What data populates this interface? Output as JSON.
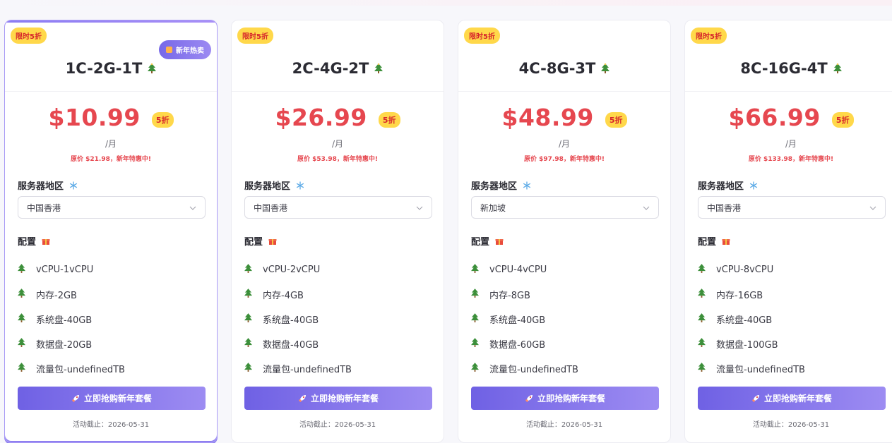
{
  "plans": [
    {
      "limited_tag": "限时5折",
      "hot_badge": "新年热卖",
      "title": "1C-2G-1T",
      "price": "$10.99",
      "discount": "5折",
      "per_month": "/月",
      "original_price": "原价 $21.98，新年特惠中!",
      "region_label": "服务器地区",
      "region_value": "中国香港",
      "config_label": "配置",
      "specs": [
        "vCPU-1vCPU",
        "内存-2GB",
        "系统盘-40GB",
        "数据盘-20GB",
        "流量包-undefinedTB"
      ],
      "cta": "立即抢购新年套餐",
      "deadline": "活动截止：2026-05-31"
    },
    {
      "limited_tag": "限时5折",
      "title": "2C-4G-2T",
      "price": "$26.99",
      "discount": "5折",
      "per_month": "/月",
      "original_price": "原价 $53.98，新年特惠中!",
      "region_label": "服务器地区",
      "region_value": "中国香港",
      "config_label": "配置",
      "specs": [
        "vCPU-2vCPU",
        "内存-4GB",
        "系统盘-40GB",
        "数据盘-40GB",
        "流量包-undefinedTB"
      ],
      "cta": "立即抢购新年套餐",
      "deadline": "活动截止：2026-05-31"
    },
    {
      "limited_tag": "限时5折",
      "title": "4C-8G-3T",
      "price": "$48.99",
      "discount": "5折",
      "per_month": "/月",
      "original_price": "原价 $97.98，新年特惠中!",
      "region_label": "服务器地区",
      "region_value": "新加坡",
      "config_label": "配置",
      "specs": [
        "vCPU-4vCPU",
        "内存-8GB",
        "系统盘-40GB",
        "数据盘-60GB",
        "流量包-undefinedTB"
      ],
      "cta": "立即抢购新年套餐",
      "deadline": "活动截止：2026-05-31"
    },
    {
      "limited_tag": "限时5折",
      "title": "8C-16G-4T",
      "price": "$66.99",
      "discount": "5折",
      "per_month": "/月",
      "original_price": "原价 $133.98，新年特惠中!",
      "region_label": "服务器地区",
      "region_value": "中国香港",
      "config_label": "配置",
      "specs": [
        "vCPU-8vCPU",
        "内存-16GB",
        "系统盘-40GB",
        "数据盘-100GB",
        "流量包-undefinedTB"
      ],
      "cta": "立即抢购新年套餐",
      "deadline": "活动截止：2026-05-31"
    }
  ],
  "icons": {
    "tree": "christmas-tree-icon",
    "snowflake": "snowflake-icon",
    "gift": "gift-icon",
    "rocket": "rocket-icon",
    "chevron": "chevron-down-icon"
  },
  "colors": {
    "price_red": "#e6474f",
    "accent_purple": "#7768e8",
    "tag_yellow": "#ffd84a"
  }
}
